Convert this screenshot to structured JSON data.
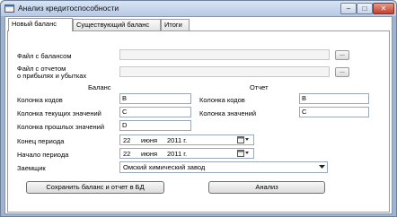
{
  "window": {
    "title": "Анализ кредитоспособности",
    "minimize_glyph": "–",
    "maximize_glyph": "□",
    "close_glyph": "✕"
  },
  "tabs": [
    {
      "label": "Новый баланс",
      "active": true
    },
    {
      "label": "Существующий баланс",
      "active": false
    },
    {
      "label": "Итоги",
      "active": false
    }
  ],
  "files": {
    "balance_label": "Файл с балансом",
    "balance_value": "",
    "report_label_line1": "Файл с отчетом",
    "report_label_line2": "о прибылях и убытках",
    "report_value": "",
    "browse_label": "..."
  },
  "balance": {
    "heading": "Баланс",
    "codes_label": "Колонка кодов",
    "codes_value": "B",
    "current_label": "Колонка текущих значений",
    "current_value": "C",
    "past_label": "Колонка прошлых значений",
    "past_value": "D"
  },
  "report": {
    "heading": "Отчет",
    "codes_label": "Колонка кодов",
    "codes_value": "B",
    "values_label": "Колонка значений",
    "values_value": "C"
  },
  "period": {
    "end_label": "Конец периода",
    "end_day": "22",
    "end_month": "июня",
    "end_year": "2011 г.",
    "start_label": "Начало периода",
    "start_day": "22",
    "start_month": "июня",
    "start_year": "2011 г."
  },
  "borrower": {
    "label": "Заемщик",
    "value": "Омский химический завод"
  },
  "actions": {
    "save_label": "Сохранить баланс и отчет в БД",
    "analyze_label": "Анализ"
  },
  "icons": [
    "app-icon",
    "calendar-icon",
    "dropdown-arrow-icon"
  ],
  "colors": {
    "frame": "#9fb3cf",
    "close_button": "#c5402a"
  }
}
